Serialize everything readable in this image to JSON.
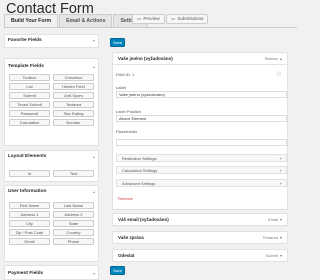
{
  "page": {
    "title": "Contact Form"
  },
  "tabs": [
    "Build Your Form",
    "Email & Actions",
    "Settings"
  ],
  "pills": {
    "preview": "Preview",
    "submissions": "Submissions"
  },
  "left": {
    "favorites": {
      "title": "Favorite Fields"
    },
    "template": {
      "title": "Template Fields",
      "items": [
        "Textbox",
        "Checkbox",
        "List",
        "Hidden Field",
        "Submit",
        "Anti-Spam",
        "Timed Submit",
        "Textarea",
        "Password",
        "Star Rating",
        "Calculation",
        "Number"
      ]
    },
    "layout": {
      "title": "Layout Elements",
      "items": [
        "hr",
        "Text"
      ]
    },
    "user": {
      "title": "User Information",
      "items": [
        "First Name",
        "Last Name",
        "Address 1",
        "Address 2",
        "City",
        "State",
        "Zip / Post Code",
        "Country",
        "Email",
        "Phone"
      ]
    },
    "payment": {
      "title": "Payment Fields"
    }
  },
  "save_label": "Save",
  "fields": [
    {
      "name": "Vaše jméno (vyžadováno)",
      "type": "Textbox"
    },
    {
      "name": "Váš email (vyžadováno)",
      "type": "Email"
    },
    {
      "name": "Vaše zpráva",
      "type": "Textarea"
    },
    {
      "name": "Odeslat",
      "type": "Submit"
    }
  ],
  "editor": {
    "field_id": "Field ID: 1",
    "label_label": "Label",
    "label_value": "Vaše jméno (vyžadováno)",
    "position_label": "Label Position",
    "position_value": "Above Element",
    "placeholder_label": "Placeholder",
    "placeholder_value": "",
    "sections": [
      "Restriction Settings",
      "Calculation Settings",
      "Advanced Settings"
    ],
    "remove": "Remove"
  }
}
